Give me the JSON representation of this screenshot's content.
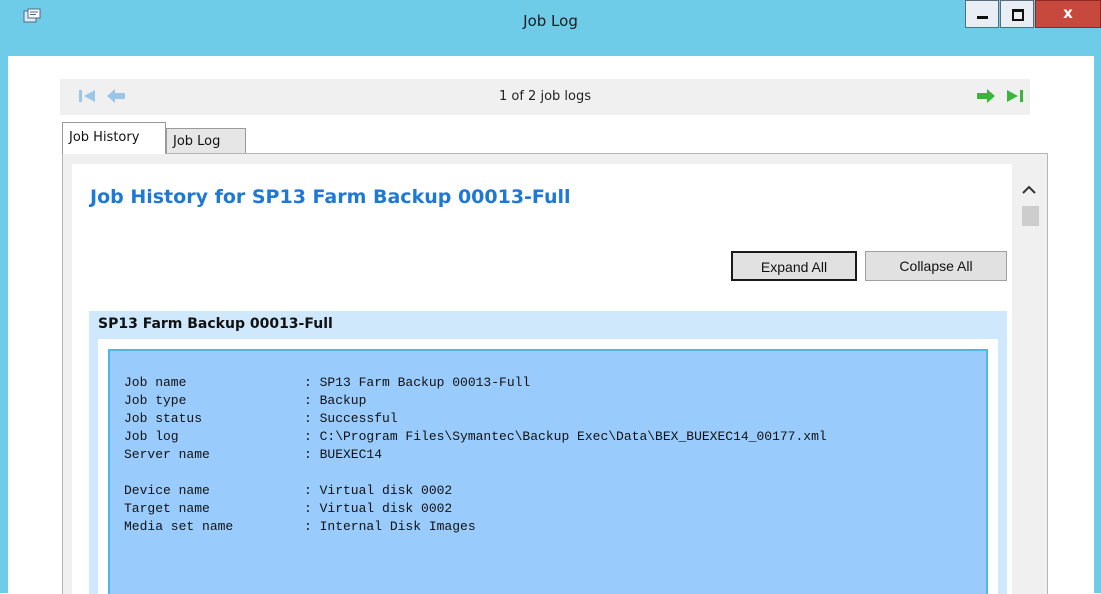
{
  "window": {
    "title": "Job Log",
    "controls": {
      "minimize": "minimize",
      "maximize": "maximize",
      "close_glyph": "x"
    }
  },
  "nav": {
    "position_text": "1 of 2 job logs",
    "first_icon": "first-log-icon",
    "prev_icon": "previous-log-icon",
    "next_icon": "next-log-icon",
    "last_icon": "last-log-icon"
  },
  "tabs": [
    {
      "label": "Job History",
      "active": true
    },
    {
      "label": "Job Log",
      "active": false
    }
  ],
  "history": {
    "title": "Job History for SP13 Farm Backup 00013-Full",
    "expand_label": "Expand All",
    "collapse_label": "Collapse All",
    "section_title": "SP13 Farm Backup 00013-Full",
    "details": [
      {
        "key": "Job name",
        "value": ": SP13 Farm Backup 00013-Full"
      },
      {
        "key": "Job type",
        "value": ": Backup"
      },
      {
        "key": "Job status",
        "value": ": Successful"
      },
      {
        "key": "Job log",
        "value": ": C:\\Program Files\\Symantec\\Backup Exec\\Data\\BEX_BUEXEC14_00177.xml"
      },
      {
        "key": "Server name",
        "value": ": BUEXEC14"
      },
      {
        "key": "Device name",
        "value": ": Virtual disk 0002"
      },
      {
        "key": "Target name",
        "value": ": Virtual disk 0002"
      },
      {
        "key": "Media set name",
        "value": ": Internal Disk Images"
      }
    ]
  },
  "colors": {
    "title_bar": "#6ecce8",
    "heading_blue": "#1e78d6",
    "detail_bg": "#99ccfd",
    "section_bg": "#cfe8fb",
    "nav_arrow_disabled": "#9cc6e8",
    "nav_arrow_enabled": "#3db53d"
  }
}
